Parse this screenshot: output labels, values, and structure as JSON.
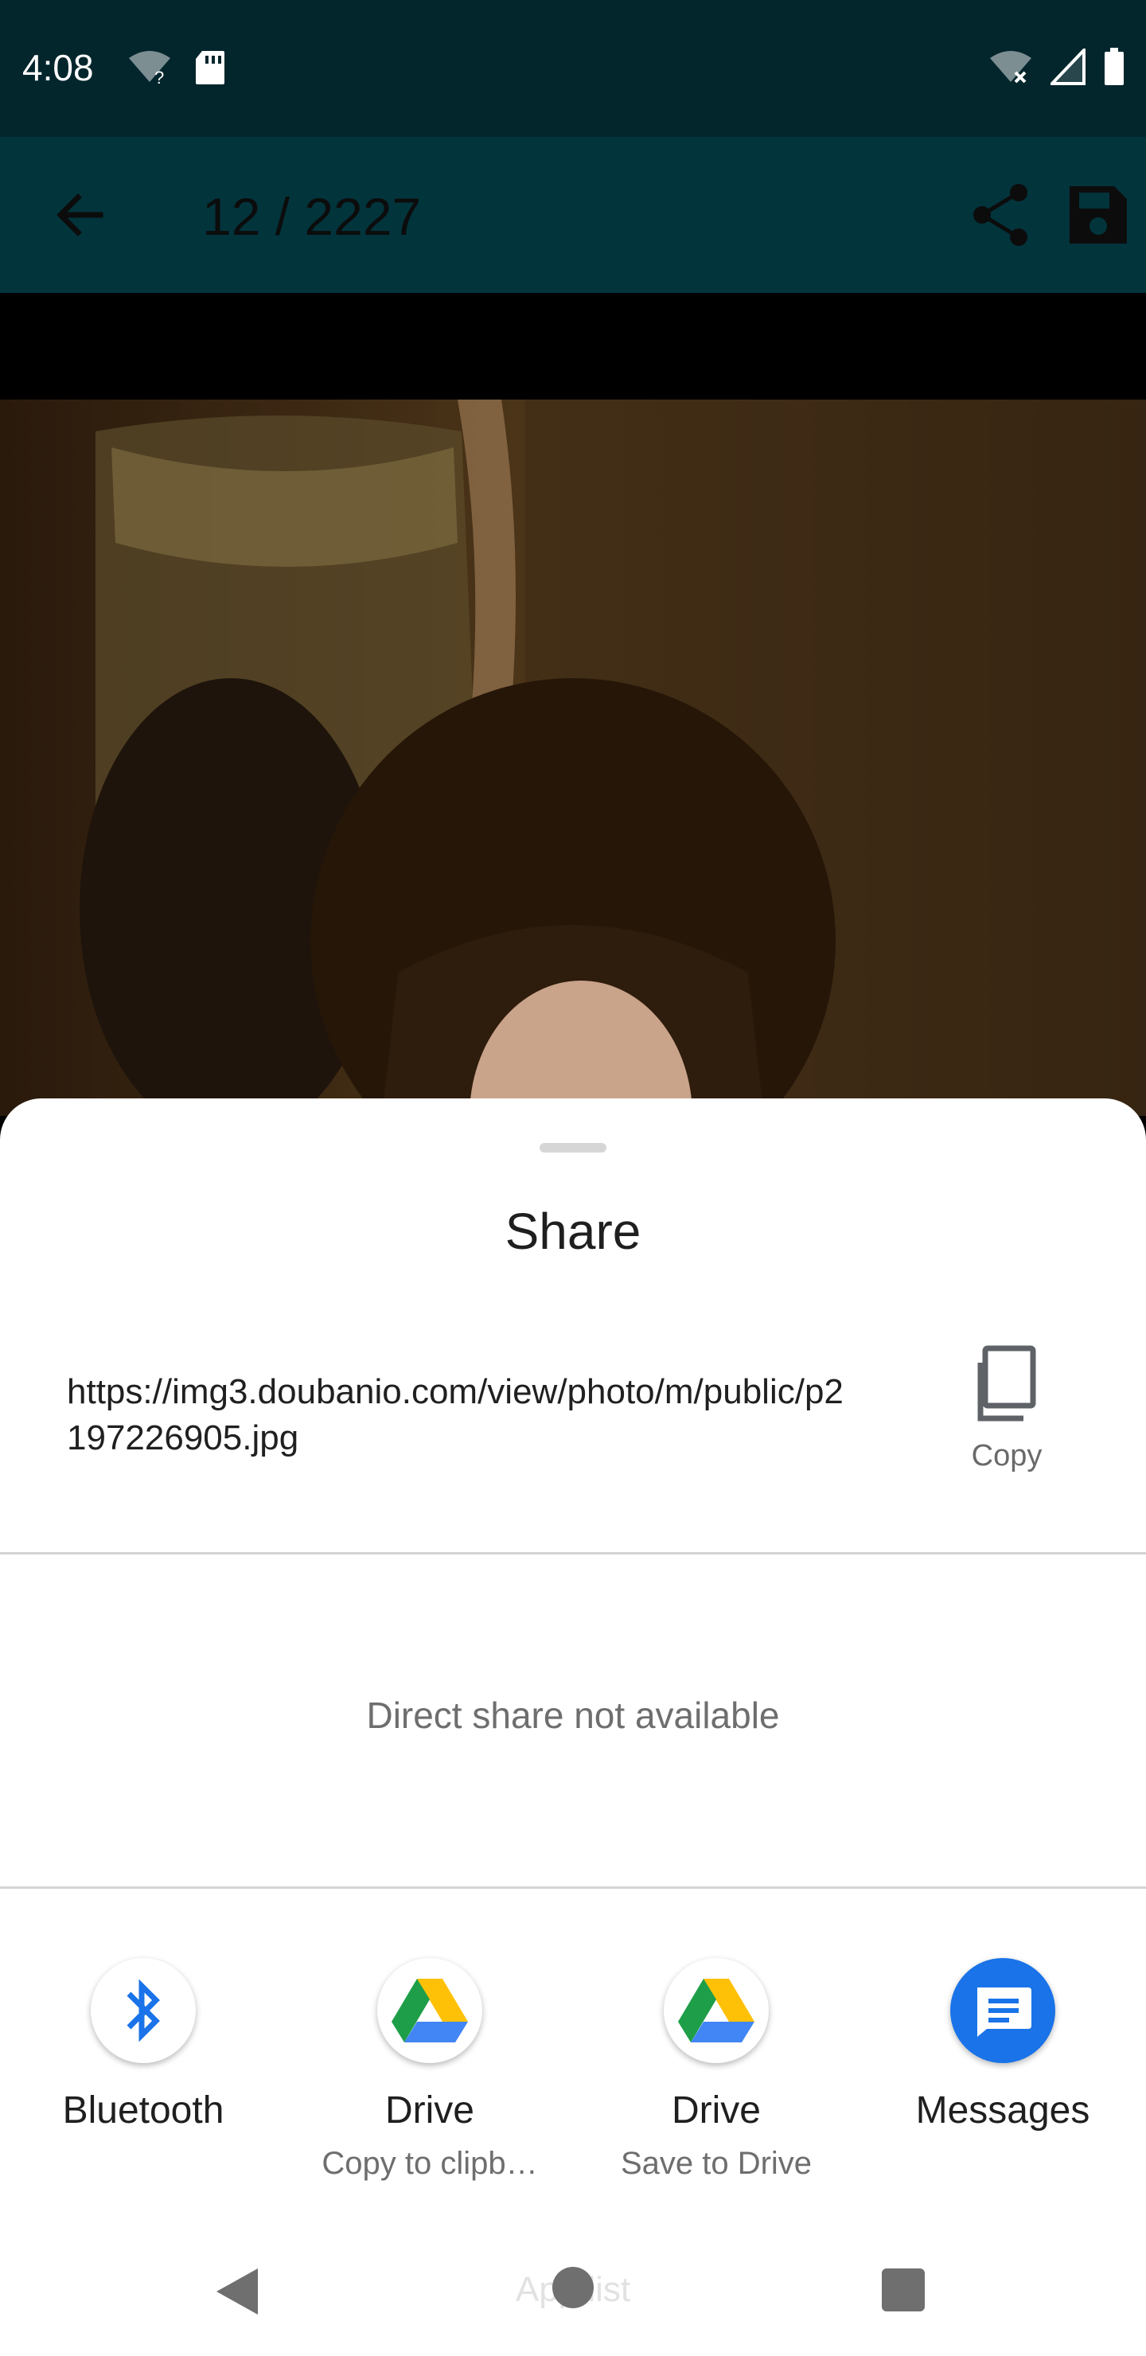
{
  "status_bar": {
    "time": "4:08",
    "icons_left": [
      "wifi-unknown-icon",
      "sd-card-icon"
    ],
    "icons_right": [
      "wifi-off-icon",
      "cell-signal-icon",
      "battery-icon"
    ]
  },
  "app_bar": {
    "counter": "12 / 2227",
    "back_icon": "arrow-back-icon",
    "share_icon": "share-icon",
    "save_icon": "save-icon",
    "background": "#02343c"
  },
  "share_sheet": {
    "title": "Share",
    "url": "https://img3.doubanio.com/view/photo/m/public/p2197226905.jpg",
    "copy_label": "Copy",
    "direct_share_text": "Direct share not available",
    "apps": [
      {
        "label": "Bluetooth",
        "sublabel": "",
        "icon": "bluetooth-icon"
      },
      {
        "label": "Drive",
        "sublabel": "Copy to clipb…",
        "icon": "google-drive-icon"
      },
      {
        "label": "Drive",
        "sublabel": "Save to Drive",
        "icon": "google-drive-icon"
      },
      {
        "label": "Messages",
        "sublabel": "",
        "icon": "messages-icon"
      }
    ]
  },
  "nav_bar": {
    "ghost_label": "App list"
  },
  "colors": {
    "status_bar": "#03262d",
    "accent_blue": "#1a73e8",
    "bluetooth_blue": "#1a73e8"
  }
}
